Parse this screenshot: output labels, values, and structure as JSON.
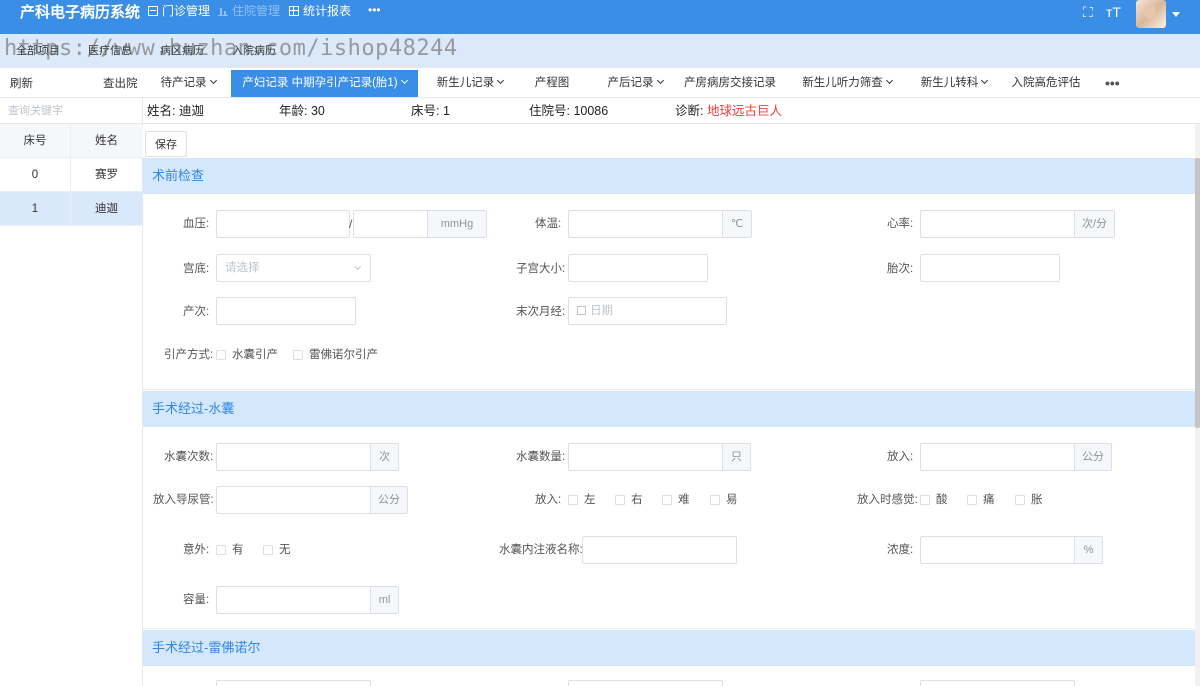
{
  "app": {
    "title": "产科电子病历系统",
    "top_nav": [
      {
        "label": "门诊管理",
        "icon": "document-icon"
      },
      {
        "label": "住院管理",
        "icon": "bar-chart-icon"
      },
      {
        "label": "统计报表",
        "icon": "grid-icon"
      }
    ],
    "top_more": "•••",
    "top_right": {
      "fullscreen_icon": "⛶",
      "font_size_icon": "тT"
    }
  },
  "sub_tabs": [
    "全部项目",
    "医疗信息",
    "病区病历",
    "入院病历"
  ],
  "watermark": "https://www.huzhan.com/ishop48244",
  "toolbar": {
    "refresh": "刷新",
    "discharge": "查出院",
    "record_tabs": [
      {
        "label": "待产记录",
        "dropdown": true,
        "active": false
      },
      {
        "label": "产妇记录 中期孕引产记录(胎1)",
        "dropdown": true,
        "active": true
      },
      {
        "label": "新生儿记录",
        "dropdown": true,
        "active": false
      },
      {
        "label": "产程图",
        "dropdown": false,
        "active": false
      },
      {
        "label": "产后记录",
        "dropdown": true,
        "active": false
      },
      {
        "label": "产房病房交接记录",
        "dropdown": false,
        "active": false
      },
      {
        "label": "新生儿听力筛查",
        "dropdown": true,
        "active": false
      },
      {
        "label": "新生儿转科",
        "dropdown": true,
        "active": false
      },
      {
        "label": "入院高危评估",
        "dropdown": false,
        "active": false
      }
    ],
    "more": "•••"
  },
  "sidebar": {
    "search_placeholder": "查询关键字",
    "columns": [
      "床号",
      "姓名"
    ],
    "rows": [
      {
        "bed": "0",
        "name": "赛罗",
        "selected": false
      },
      {
        "bed": "1",
        "name": "迪迦",
        "selected": true
      }
    ]
  },
  "patient": {
    "name": "姓名: 迪迦",
    "age": "年龄: 30",
    "bed": "床号: 1",
    "admission_no": "住院号: 10086",
    "diagnosis_label": "诊断: ",
    "diagnosis_value": "地球远古巨人",
    "diagnosis_color": "#f03c3c"
  },
  "form": {
    "save_label": "保存",
    "sections": [
      {
        "title": "术前检查",
        "fields": {
          "bp_label": "血压:",
          "bp_sep": "/",
          "bp_unit": "mmHg",
          "temp_label": "体温:",
          "temp_unit": "℃",
          "hr_label": "心率:",
          "hr_unit": "次/分",
          "fundus_label": "宫底:",
          "fundus_placeholder": "请选择",
          "uterus_label": "子宫大小:",
          "gravidity_label": "胎次:",
          "parity_label": "产次:",
          "lmp_label": "末次月经:",
          "lmp_placeholder": "日期",
          "induction_label": "引产方式:",
          "induction_options": [
            "水囊引产",
            "雷佛诺尔引产"
          ]
        }
      },
      {
        "title": "手术经过-水囊",
        "fields": {
          "count_label": "水囊次数:",
          "count_unit": "次",
          "qty_label": "水囊数量:",
          "qty_unit": "只",
          "insert_label": "放入:",
          "insert_unit": "公分",
          "catheter_label": "放入导尿管:",
          "catheter_unit": "公分",
          "insert2_label": "放入:",
          "insert2_options": [
            "左",
            "右",
            "难",
            "易"
          ],
          "feeling_label": "放入时感觉:",
          "feeling_options": [
            "酸",
            "痛",
            "胀"
          ],
          "accident_label": "意外:",
          "accident_options": [
            "有",
            "无"
          ],
          "liquid_label": "水囊内注液名称:",
          "concentration_label": "浓度:",
          "concentration_unit": "%",
          "volume_label": "容量:",
          "volume_unit": "ml"
        }
      },
      {
        "title": "手术经过-雷佛诺尔"
      }
    ]
  },
  "colors": {
    "primary": "#3a8ee6",
    "section_bg": "#d5e8fb",
    "section_text": "#2f86e4"
  }
}
